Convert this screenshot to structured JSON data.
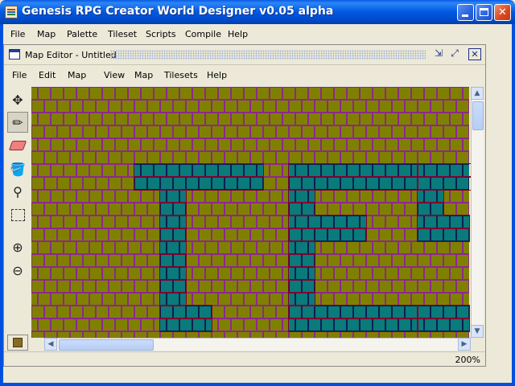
{
  "window": {
    "title": "Genesis RPG Creator World Designer v0.05 alpha",
    "controls": [
      "minimize",
      "maximize",
      "close"
    ]
  },
  "main_menu": [
    "File",
    "Map",
    "Palette",
    "Tileset",
    "Scripts",
    "Compile",
    "Help"
  ],
  "editor": {
    "title": "Map Editor - Untitled",
    "menu": [
      "File",
      "Edit",
      "Map",
      "View",
      "Map",
      "Tilesets",
      "Help"
    ],
    "tools": [
      {
        "name": "move-icon",
        "selected": false
      },
      {
        "name": "pencil-icon",
        "selected": true
      },
      {
        "name": "eraser-icon",
        "selected": false
      },
      {
        "name": "fill-bucket-icon",
        "selected": false
      },
      {
        "name": "eyedropper-icon",
        "selected": false
      },
      {
        "name": "selection-icon",
        "selected": false
      },
      {
        "name": "zoom-in-icon",
        "selected": false
      },
      {
        "name": "zoom-out-icon",
        "selected": false
      }
    ],
    "zoom_label": "200%",
    "colors": {
      "brick": "#808000",
      "brick_mortar": "#8a2a8a",
      "water": "#0a7a7a",
      "water_mortar": "#0a2050",
      "wall_outline": "#800030"
    },
    "map": {
      "cols": 34,
      "rows": 20,
      "water_runs": [
        [
          8,
          6,
          10
        ],
        [
          20,
          6,
          10
        ],
        [
          30,
          6,
          10
        ],
        [
          8,
          7,
          10
        ],
        [
          20,
          7,
          10
        ],
        [
          30,
          7,
          10
        ],
        [
          10,
          8,
          2
        ],
        [
          20,
          8,
          2
        ],
        [
          30,
          8,
          2
        ],
        [
          10,
          9,
          2
        ],
        [
          20,
          9,
          2
        ],
        [
          30,
          9,
          2
        ],
        [
          10,
          10,
          2
        ],
        [
          20,
          10,
          6
        ],
        [
          30,
          10,
          4
        ],
        [
          10,
          11,
          2
        ],
        [
          20,
          11,
          6
        ],
        [
          30,
          11,
          4
        ],
        [
          10,
          12,
          2
        ],
        [
          20,
          12,
          2
        ],
        [
          10,
          13,
          2
        ],
        [
          20,
          13,
          2
        ],
        [
          10,
          14,
          2
        ],
        [
          20,
          14,
          2
        ],
        [
          10,
          15,
          2
        ],
        [
          20,
          15,
          2
        ],
        [
          10,
          16,
          2
        ],
        [
          20,
          16,
          2
        ],
        [
          10,
          17,
          4
        ],
        [
          20,
          17,
          10
        ],
        [
          30,
          17,
          4
        ],
        [
          10,
          18,
          4
        ],
        [
          20,
          18,
          10
        ],
        [
          30,
          18,
          4
        ]
      ]
    }
  },
  "scrollbars": {
    "vertical_position": 0.05,
    "horizontal_position": 0.25
  }
}
